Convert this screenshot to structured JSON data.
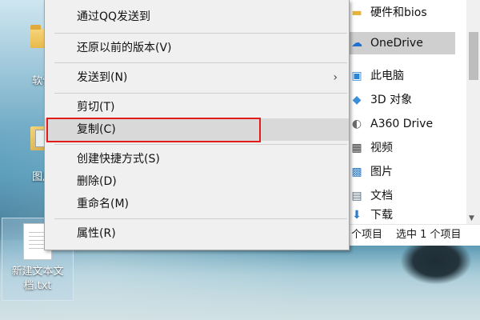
{
  "desktop": {
    "icons": [
      {
        "label": "软件",
        "type": "folder"
      },
      {
        "label": "图片",
        "type": "photo"
      },
      {
        "label": "新建文本文档.txt",
        "type": "txt"
      }
    ]
  },
  "context_menu": {
    "items": [
      {
        "label": "通过QQ发送到"
      },
      {
        "label": "还原以前的版本(V)"
      },
      {
        "label": "发送到(N)",
        "submenu_icon": "chevron-right-icon"
      },
      {
        "label": "剪切(T)"
      },
      {
        "label": "复制(C)",
        "highlighted": true
      },
      {
        "label": "创建快捷方式(S)"
      },
      {
        "label": "删除(D)"
      },
      {
        "label": "重命名(M)"
      },
      {
        "label": "属性(R)"
      }
    ],
    "highlight_color": "#e21b1b"
  },
  "explorer": {
    "nav": [
      {
        "label": "硬件和bios",
        "icon": "folder-icon"
      },
      {
        "label": "OneDrive",
        "icon": "cloud-icon",
        "selected": true
      },
      {
        "label": "此电脑",
        "icon": "computer-icon"
      },
      {
        "label": "3D 对象",
        "icon": "cube-icon"
      },
      {
        "label": "A360 Drive",
        "icon": "a360-icon"
      },
      {
        "label": "视频",
        "icon": "video-icon"
      },
      {
        "label": "图片",
        "icon": "picture-icon"
      },
      {
        "label": "文档",
        "icon": "document-icon"
      },
      {
        "label": "下载",
        "icon": "download-icon"
      }
    ],
    "status": {
      "items_text": "个项目",
      "selected_text": "选中 1 个项目"
    }
  }
}
